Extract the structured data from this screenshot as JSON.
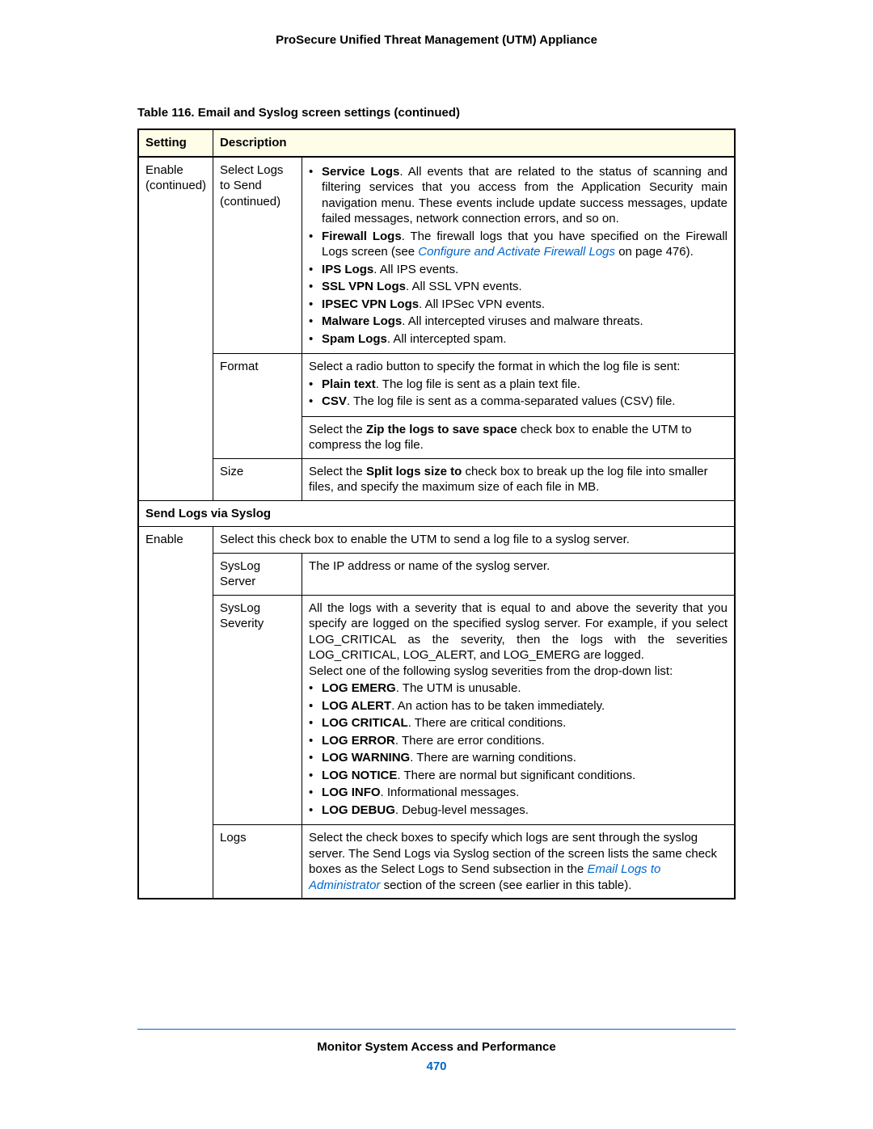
{
  "header": "ProSecure Unified Threat Management (UTM) Appliance",
  "caption": "Table 116.  Email and Syslog screen settings (continued)",
  "th_setting": "Setting",
  "th_desc": "Description",
  "r1_setting": "Enable (continued)",
  "r1_sub": "Select Logs to Send (continued)",
  "r1_b1_pre": "Service Logs",
  "r1_b1_txt": ". All events that are related to the status of scanning and filtering services that you access from the Application Security main navigation menu. These events include update success messages, update failed messages, network connection errors, and so on.",
  "r1_b2_pre": "Firewall Logs",
  "r1_b2_txt1": ". The firewall logs that you have specified on the Firewall Logs screen (see ",
  "r1_b2_link": "Configure and Activate Firewall Logs",
  "r1_b2_txt2": " on page 476).",
  "r1_b3_pre": "IPS Logs",
  "r1_b3_txt": ". All IPS events.",
  "r1_b4_pre": "SSL VPN Logs",
  "r1_b4_txt": ". All SSL VPN events.",
  "r1_b5_pre": "IPSEC VPN Logs",
  "r1_b5_txt": ". All IPSec VPN events.",
  "r1_b6_pre": "Malware Logs",
  "r1_b6_txt": ". All intercepted viruses and malware threats.",
  "r1_b7_pre": "Spam Logs",
  "r1_b7_txt": ". All intercepted spam.",
  "r2_sub": "Format",
  "r2_intro": "Select a radio button to specify the format in which the log file is sent:",
  "r2_b1_pre": "Plain text",
  "r2_b1_txt": ". The log file is sent as a plain text file.",
  "r2_b2_pre": "CSV",
  "r2_b2_txt": ". The log file is sent as a comma-separated values (CSV) file.",
  "r3_txt1": "Select the ",
  "r3_bold": "Zip the logs to save space",
  "r3_txt2": " check box to enable the UTM to compress the log file.",
  "r4_sub": "Size",
  "r4_txt1": "Select the ",
  "r4_bold": "Split logs size to",
  "r4_txt2": " check box to break up the log file into smaller files, and specify the maximum size of each file in MB.",
  "sec2": "Send Logs via Syslog",
  "r5_setting": "Enable",
  "r5_txt": "Select this check box to enable the UTM to send a log file to a syslog server.",
  "r6_sub": "SysLog Server",
  "r6_txt": "The IP address or name of the syslog server.",
  "r7_sub": "SysLog Severity",
  "r7_intro": "All the logs with a severity that is equal to and above the severity that you specify are logged on the specified syslog server. For example, if you select LOG_CRITICAL as the severity, then the logs with the severities LOG_CRITICAL, LOG_ALERT, and LOG_EMERG are logged.",
  "r7_intro2": "Select one of the following syslog severities from the drop-down list:",
  "r7_b1_pre": "LOG EMERG",
  "r7_b1_txt": ". The UTM is unusable.",
  "r7_b2_pre": "LOG ALERT",
  "r7_b2_txt": ". An action has to be taken immediately.",
  "r7_b3_pre": "LOG CRITICAL",
  "r7_b3_txt": ". There are critical conditions.",
  "r7_b4_pre": "LOG ERROR",
  "r7_b4_txt": ". There are error conditions.",
  "r7_b5_pre": "LOG WARNING",
  "r7_b5_txt": ". There are warning conditions.",
  "r7_b6_pre": "LOG NOTICE",
  "r7_b6_txt": ". There are normal but significant conditions.",
  "r7_b7_pre": "LOG INFO",
  "r7_b7_txt": ". Informational messages.",
  "r7_b8_pre": "LOG DEBUG",
  "r7_b8_txt": ". Debug-level messages.",
  "r8_sub": "Logs",
  "r8_txt1": "Select the check boxes to specify which logs are sent through the syslog server. The Send Logs via Syslog section of the screen lists the same check boxes as the Select Logs to Send subsection in the ",
  "r8_link": "Email Logs to Administrator",
  "r8_txt2": "  section of the screen (see earlier in this table).",
  "footer_title": "Monitor System Access and Performance",
  "page_num": "470"
}
